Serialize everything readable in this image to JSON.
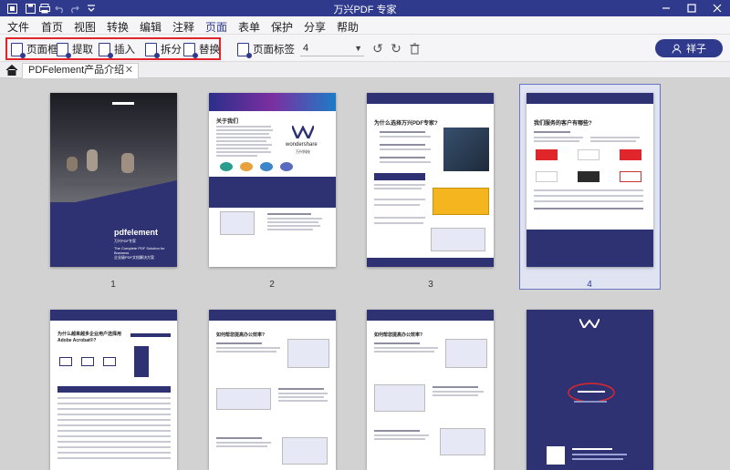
{
  "app": {
    "title": "万兴PDF 专家"
  },
  "menu": [
    "文件",
    "首页",
    "视图",
    "转换",
    "编辑",
    "注释",
    "页面",
    "表单",
    "保护",
    "分享",
    "帮助"
  ],
  "menu_active": "页面",
  "toolbar": {
    "page_box": "页面框",
    "extract": "提取",
    "insert": "插入",
    "split": "拆分",
    "replace": "替换",
    "page_labels": "页面标签",
    "page_number": "4",
    "user_name": "祥子"
  },
  "tab": {
    "label": "PDFelement产品介绍"
  },
  "pages": {
    "p1": {
      "number": "1",
      "brand": "pdfelement",
      "sub": "万兴PDF专家",
      "tagline": "The Complete PDF Solution for Business",
      "tagline_cn": "企业级PDF文档解决方案"
    },
    "p2": {
      "number": "2",
      "heading": "关于我们",
      "brand": "wondershare",
      "brand_cn": "万兴科技"
    },
    "p3": {
      "number": "3",
      "heading": "为什么选择万兴PDF专家?"
    },
    "p4": {
      "number": "4",
      "heading": "我们服务的客户有哪些?"
    },
    "p5": {
      "heading": "为什么越来越多企业用户选择用 Adobe Acrobat®?"
    },
    "p6": {
      "heading": "如何帮您提高办公效率?"
    },
    "p7": {
      "heading": "如何帮您提高办公效率?"
    }
  },
  "colors": {
    "brand": "#2f3a8c",
    "highlight": "#e0262b",
    "cover": "#2e3272"
  }
}
